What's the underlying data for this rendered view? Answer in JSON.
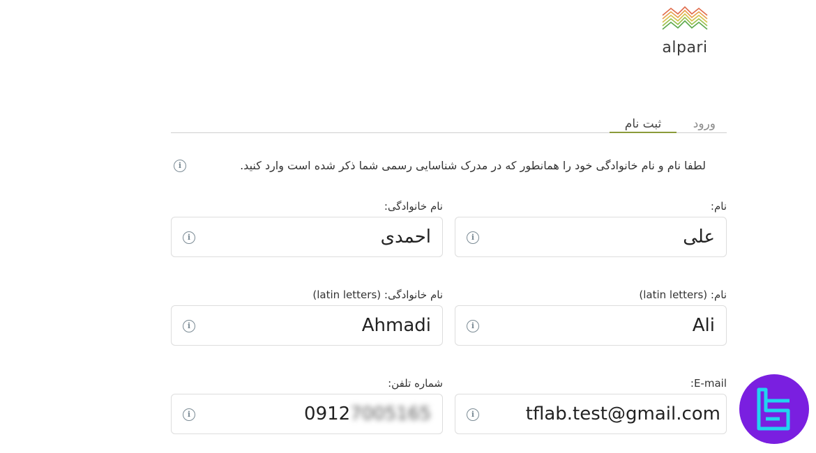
{
  "logo": {
    "wordmark": "alpari"
  },
  "tabs": {
    "login": "ورود",
    "register": "ثبت نام"
  },
  "notice": {
    "text": "لطفا نام و نام خانوادگی خود را همانطور که در مدرک شناسایی رسمی شما ذکر شده است وارد کنید."
  },
  "form": {
    "first_name": {
      "label": "نام:",
      "value": "علی"
    },
    "last_name": {
      "label": "نام خانوادگی:",
      "value": "احمدی"
    },
    "first_name_latin": {
      "label": "نام: (latin letters)",
      "value": "Ali"
    },
    "last_name_latin": {
      "label": "نام خانوادگی: (latin letters)",
      "value": "Ahmadi"
    },
    "email": {
      "label": "E-mail:",
      "value": "tflab.test@gmail.com"
    },
    "phone": {
      "label": "شماره تلفن:",
      "value_visible": "0912",
      "value_blurred": "7005165"
    }
  },
  "colors": {
    "accent": "#8a9a3a",
    "badge": "#7a1fe0",
    "badge_mark": "#21d4f0"
  },
  "icons": {
    "info": "info-circle-icon",
    "badge": "tflab-logo-icon"
  }
}
